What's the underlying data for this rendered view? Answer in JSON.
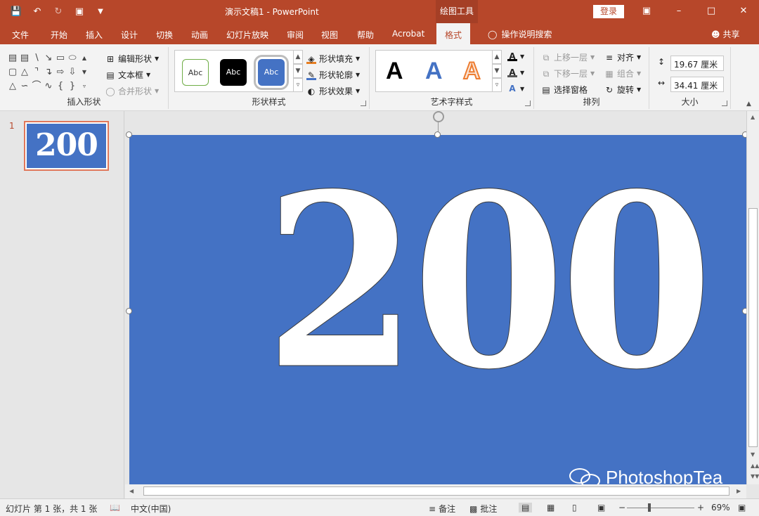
{
  "window": {
    "title": "演示文稿1  -  PowerPoint",
    "context_tab": "绘图工具",
    "login": "登录"
  },
  "ribbon_tabs": [
    "文件",
    "开始",
    "插入",
    "设计",
    "切换",
    "动画",
    "幻灯片放映",
    "审阅",
    "视图",
    "帮助",
    "Acrobat",
    "格式"
  ],
  "active_tab": "格式",
  "tell_me": "操作说明搜索",
  "share": "共享",
  "groups": {
    "insert_shapes": {
      "label": "插入形状",
      "edit_shape": "编辑形状",
      "text_box": "文本框",
      "merge_shapes": "合并形状"
    },
    "shape_styles": {
      "label": "形状样式",
      "thumbs": [
        "Abc",
        "Abc",
        "Abc"
      ],
      "fill": "形状填充",
      "outline": "形状轮廓",
      "effects": "形状效果"
    },
    "wordart_styles": {
      "label": "艺术字样式",
      "letters": [
        "A",
        "A",
        "A"
      ]
    },
    "arrange": {
      "label": "排列",
      "bring_forward": "上移一层",
      "send_backward": "下移一层",
      "selection_pane": "选择窗格",
      "align": "对齐",
      "group": "组合",
      "rotate": "旋转"
    },
    "size": {
      "label": "大小",
      "height": "19.67 厘米",
      "width": "34.41 厘米"
    }
  },
  "slides": {
    "number": "1",
    "thumb_text": "200"
  },
  "slide_content": {
    "main_text": "200"
  },
  "watermark": "PhotoshopTea",
  "status": {
    "slide_info": "幻灯片 第 1 张，共 1 张",
    "language": "中文(中国)",
    "notes": "备注",
    "comments": "批注",
    "zoom": "69%"
  },
  "colors": {
    "accent": "#b7472a",
    "slide_bg": "#4472c4"
  }
}
